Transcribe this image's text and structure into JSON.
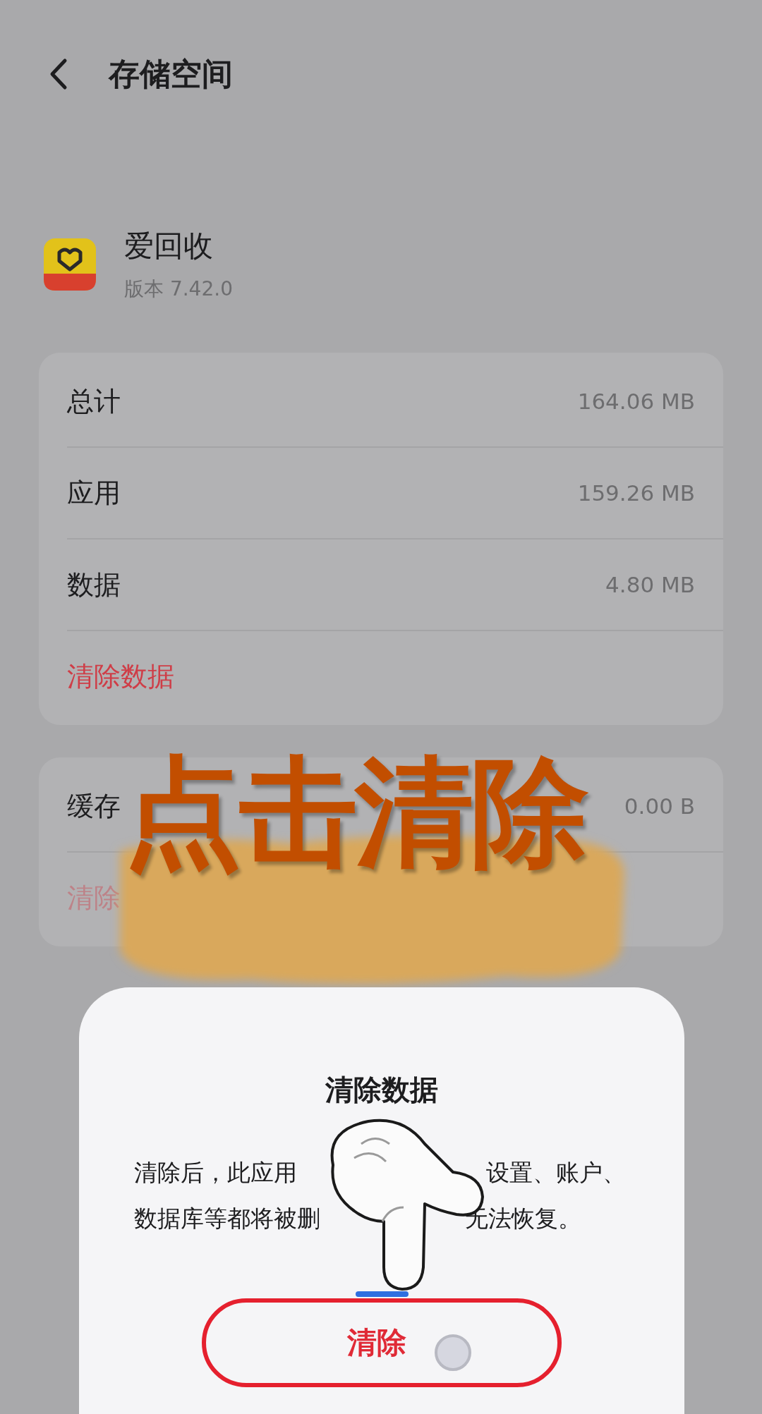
{
  "header": {
    "title": "存储空间"
  },
  "app": {
    "name": "爱回收",
    "version": "版本 7.42.0"
  },
  "storage": {
    "rows": [
      {
        "label": "总计",
        "value": "164.06 MB"
      },
      {
        "label": "应用",
        "value": "159.26 MB"
      },
      {
        "label": "数据",
        "value": "4.80 MB"
      }
    ],
    "clear_link": {
      "label": "清除数据",
      "disabled": false
    }
  },
  "cache": {
    "label": "缓存",
    "value": "0.00 B",
    "clear_link": {
      "label": "清除",
      "disabled": true
    }
  },
  "caption": "点击清除",
  "dialog": {
    "title": "清除数据",
    "message_lines": [
      [
        "清除后，此应用",
        "设置、账户、"
      ],
      [
        "数据库等都将被删",
        "无法恢复。"
      ]
    ],
    "button": "清除"
  }
}
